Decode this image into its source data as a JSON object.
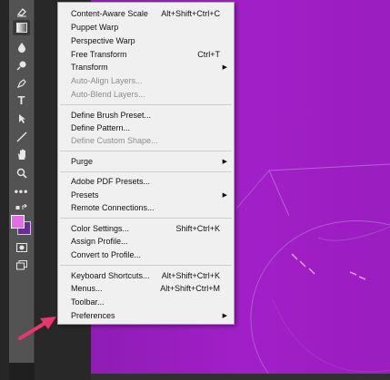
{
  "menu": {
    "items": [
      {
        "label": "Content-Aware Scale",
        "shortcut": "Alt+Shift+Ctrl+C"
      },
      {
        "label": "Puppet Warp",
        "shortcut": ""
      },
      {
        "label": "Perspective Warp",
        "shortcut": ""
      },
      {
        "label": "Free Transform",
        "shortcut": "Ctrl+T"
      },
      {
        "label": "Transform",
        "shortcut": ""
      },
      {
        "label": "Auto-Align Layers...",
        "shortcut": ""
      },
      {
        "label": "Auto-Blend Layers...",
        "shortcut": ""
      },
      {
        "label": "Define Brush Preset...",
        "shortcut": ""
      },
      {
        "label": "Define Pattern...",
        "shortcut": ""
      },
      {
        "label": "Define Custom Shape...",
        "shortcut": ""
      },
      {
        "label": "Purge",
        "shortcut": ""
      },
      {
        "label": "Adobe PDF Presets...",
        "shortcut": ""
      },
      {
        "label": "Presets",
        "shortcut": ""
      },
      {
        "label": "Remote Connections...",
        "shortcut": ""
      },
      {
        "label": "Color Settings...",
        "shortcut": "Shift+Ctrl+K"
      },
      {
        "label": "Assign Profile...",
        "shortcut": ""
      },
      {
        "label": "Convert to Profile...",
        "shortcut": ""
      },
      {
        "label": "Keyboard Shortcuts...",
        "shortcut": "Alt+Shift+Ctrl+K"
      },
      {
        "label": "Menus...",
        "shortcut": "Alt+Shift+Ctrl+M"
      },
      {
        "label": "Toolbar...",
        "shortcut": ""
      },
      {
        "label": "Preferences",
        "shortcut": ""
      }
    ]
  },
  "colors": {
    "foreground": "#e36ce9",
    "background": "#6a2a9a",
    "canvas": "#9b1ec0",
    "pointer": "#e8366e"
  }
}
